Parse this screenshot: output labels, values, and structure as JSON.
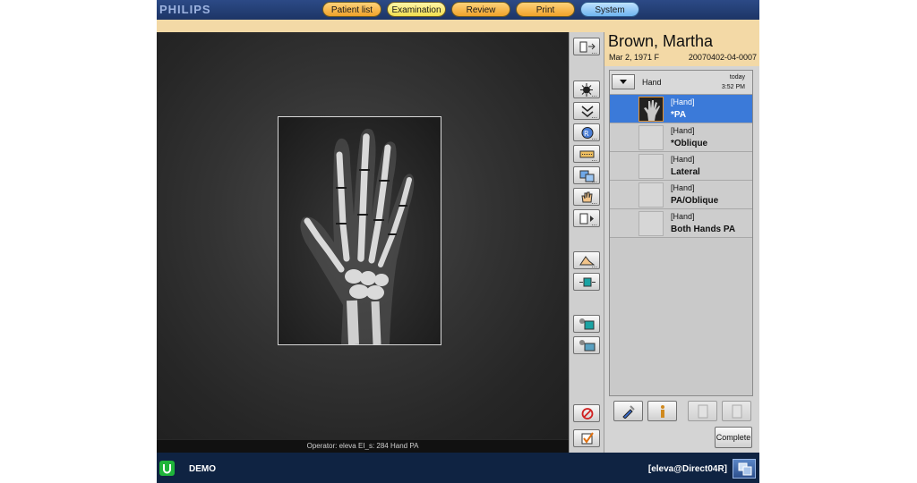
{
  "brand": "PHILIPS",
  "tabs": [
    {
      "label": "Patient list",
      "style": "orange"
    },
    {
      "label": "Examination",
      "style": "yellow",
      "active": true
    },
    {
      "label": "Review",
      "style": "orange"
    },
    {
      "label": "Print",
      "style": "orange"
    },
    {
      "label": "System",
      "style": "blue"
    }
  ],
  "viewer": {
    "operator_text": "Operator: eleva  EI_s: 284  Hand  PA"
  },
  "tools": [
    {
      "icon": "layout-icon"
    },
    {
      "icon": "brightness-icon"
    },
    {
      "icon": "window-level-icon"
    },
    {
      "icon": "rotate-icon"
    },
    {
      "icon": "annotation-icon"
    },
    {
      "icon": "copy-image-icon"
    },
    {
      "icon": "hand-pan-icon"
    },
    {
      "icon": "flip-icon"
    },
    {
      "icon": "measure-icon"
    },
    {
      "icon": "shutter-icon"
    },
    {
      "icon": "save-icon"
    },
    {
      "icon": "export-icon"
    },
    {
      "icon": "reject-icon"
    },
    {
      "icon": "accept-icon"
    }
  ],
  "patient": {
    "name": "Brown, Martha",
    "dob": "Mar 2, 1971  F",
    "id": "20070402-04-0007"
  },
  "exam": {
    "label": "Hand",
    "date": "today",
    "time": "3:52 PM",
    "items": [
      {
        "region": "[Hand]",
        "name": "*PA",
        "selected": true
      },
      {
        "region": "[Hand]",
        "name": "*Oblique"
      },
      {
        "region": "[Hand]",
        "name": "Lateral"
      },
      {
        "region": "[Hand]",
        "name": "PA/Oblique"
      },
      {
        "region": "[Hand]",
        "name": "Both Hands PA"
      }
    ]
  },
  "panel_buttons": {
    "complete": "Complete"
  },
  "statusbar": {
    "mode": "DEMO",
    "user": "[eleva@Direct04R]"
  }
}
